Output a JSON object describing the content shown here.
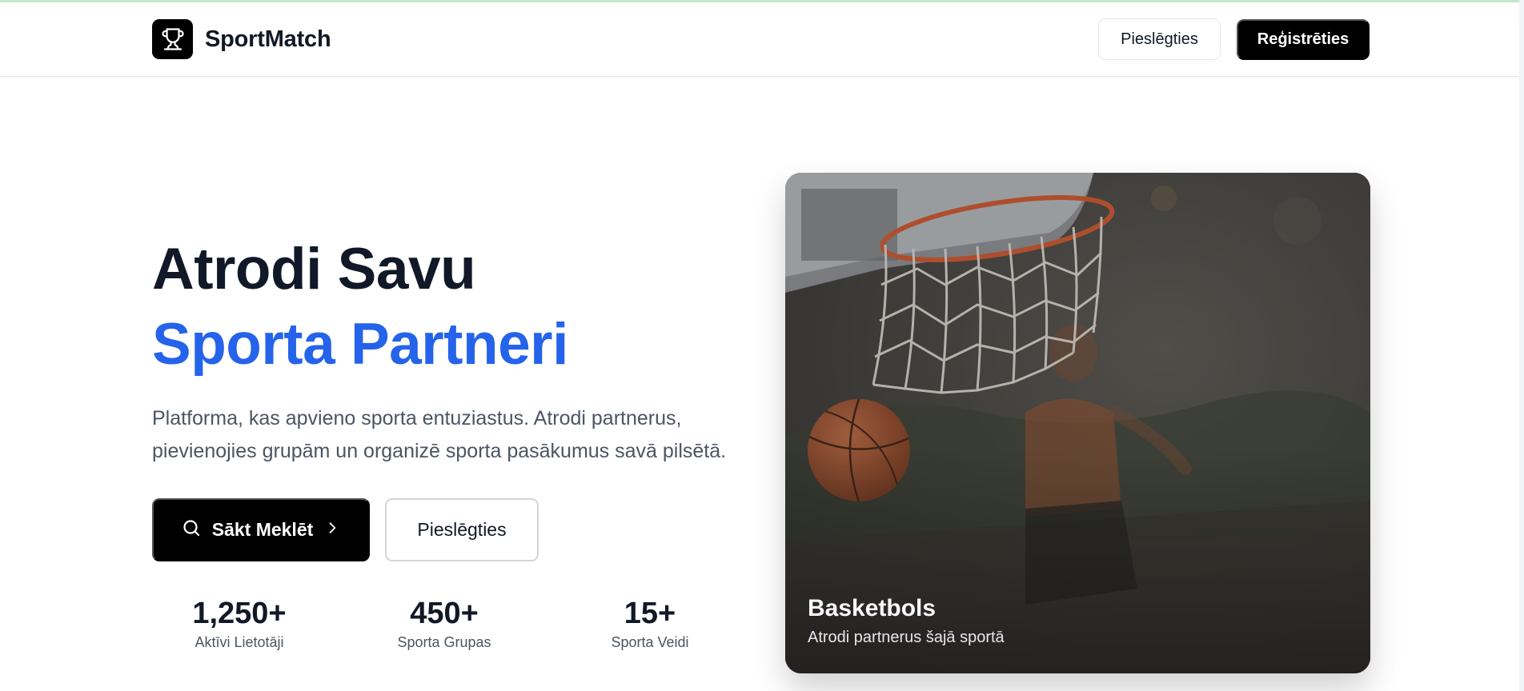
{
  "brand": {
    "name": "SportMatch",
    "logo_icon": "trophy-icon"
  },
  "nav": {
    "login_label": "Pieslēgties",
    "register_label": "Reģistrēties"
  },
  "hero": {
    "title_line1": "Atrodi Savu",
    "title_line2": "Sporta Partneri",
    "description": "Platforma, kas apvieno sporta entuziastus. Atrodi partnerus, pievienojies grupām un organizē sporta pasākumus savā pilsētā.",
    "primary_button": {
      "label": "Sākt Meklēt",
      "icon_left": "search-icon",
      "icon_right": "chevron-right-icon"
    },
    "secondary_button": {
      "label": "Pieslēgties"
    }
  },
  "stats": [
    {
      "value": "1,250+",
      "label": "Aktīvi Lietotāji"
    },
    {
      "value": "450+",
      "label": "Sporta Grupas"
    },
    {
      "value": "15+",
      "label": "Sporta Veidi"
    }
  ],
  "featured_card": {
    "title": "Basketbols",
    "subtitle": "Atrodi partnerus šajā sportā",
    "image": "basketball-hoop-photo"
  },
  "colors": {
    "accent": "#2563eb",
    "primary_button": "#000000",
    "heading": "#111827",
    "body_text": "#4b5563",
    "border": "#e5e7eb"
  }
}
